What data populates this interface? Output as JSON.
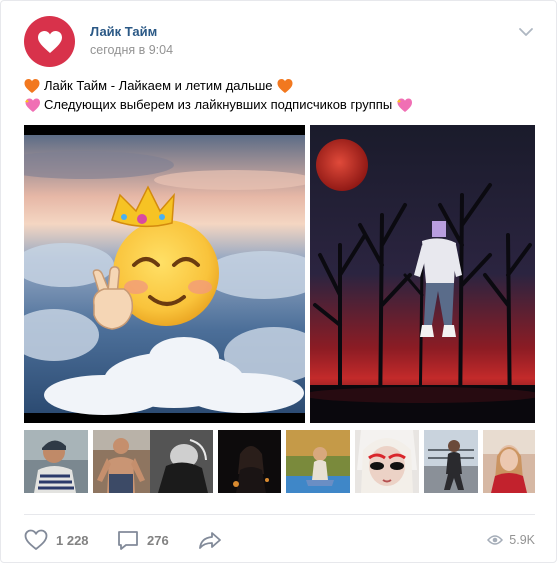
{
  "post": {
    "author": "Лайк Тайм",
    "time": "сегодня в 9:04",
    "line1": "Лайк Тайм - Лайкаем и летим дальше",
    "line2": "Следующих выберем из лайкнувших подписчиков группы"
  },
  "icons": {
    "avatar": "heart-icon",
    "menu": "chevron-down-icon",
    "line1_emoji": "orange-heart-emoji",
    "line2_emoji": "sparkling-heart-emoji",
    "like": "heart-outline-icon",
    "comment": "comment-icon",
    "share": "share-arrow-icon",
    "views": "eye-icon"
  },
  "stats": {
    "likes": "1 228",
    "comments": "276",
    "views": "5.9K"
  },
  "colors": {
    "accent": "#2a5885",
    "brand": "#d8324b",
    "muted": "#828282"
  }
}
